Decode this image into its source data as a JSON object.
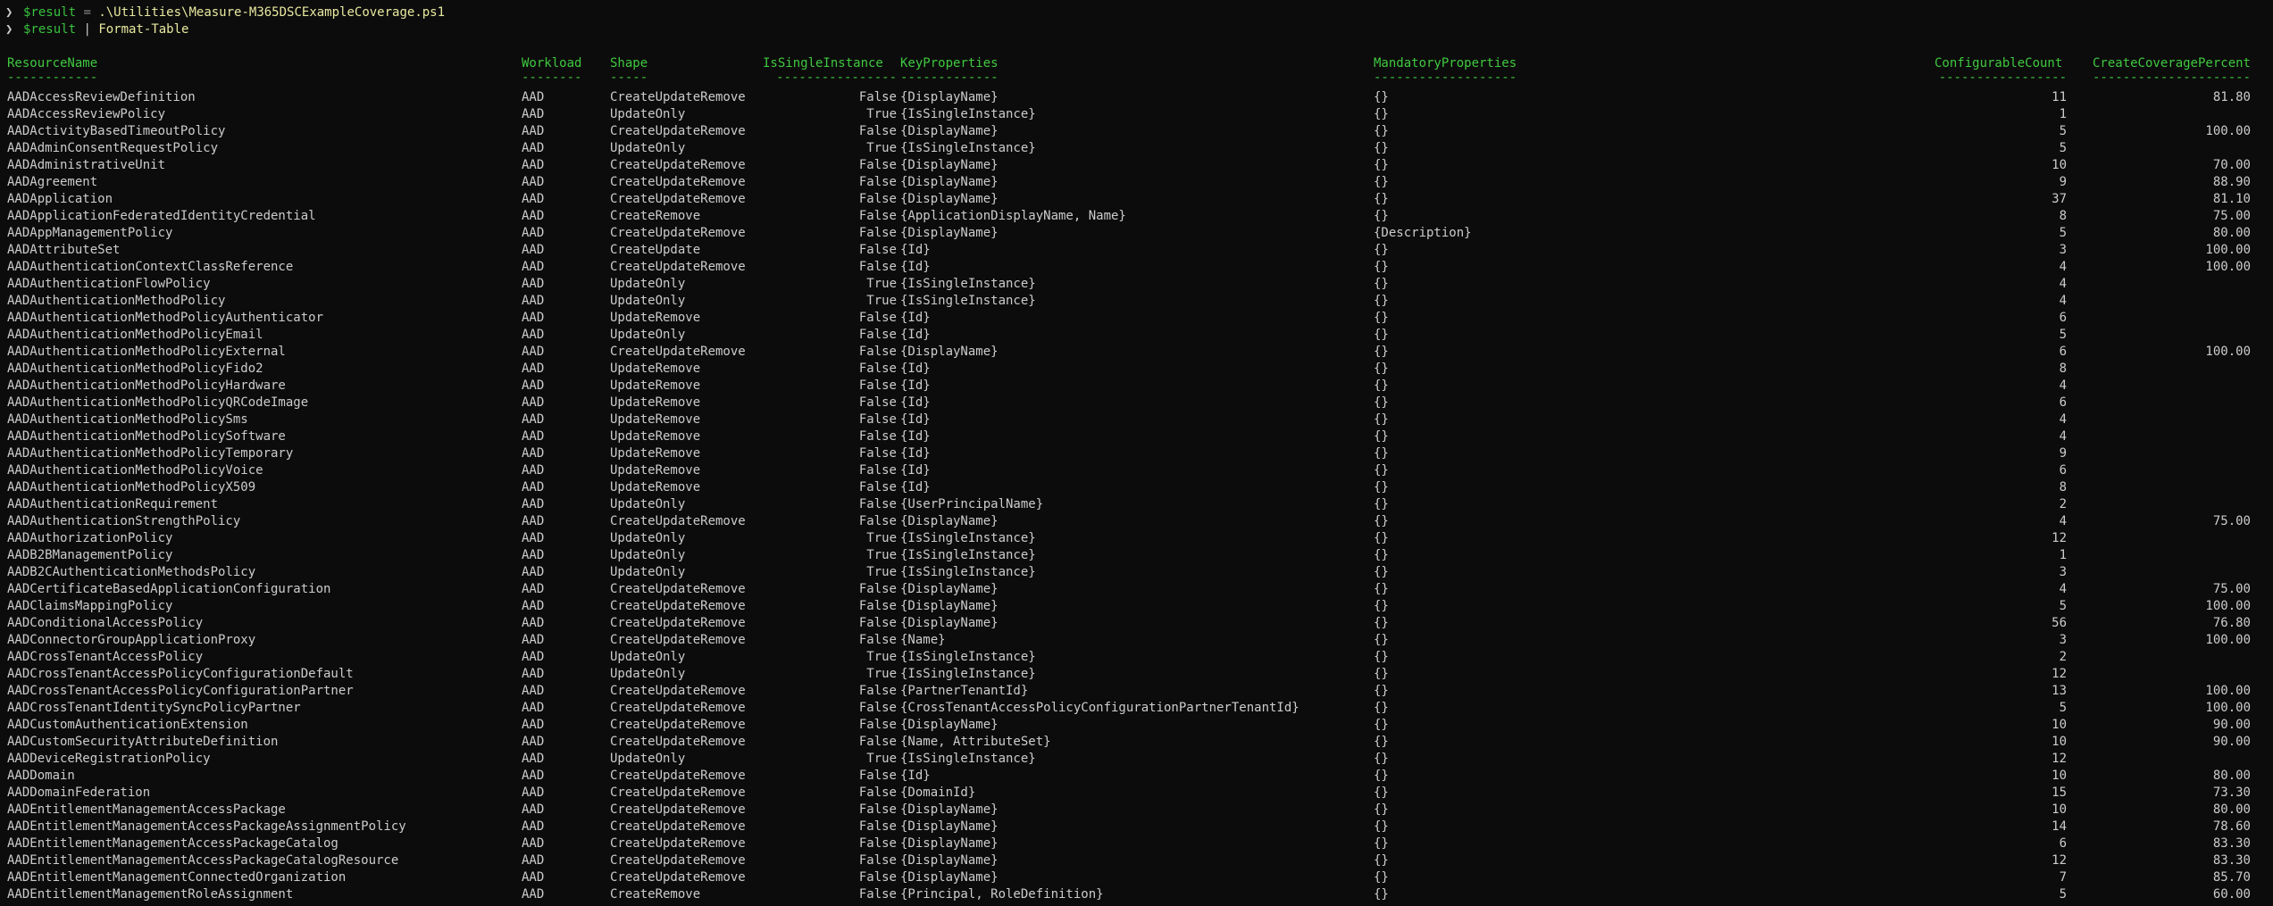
{
  "prompt": {
    "glyph": "❯",
    "line1": {
      "var": "$result",
      "op": " = ",
      "path": ".\\Utilities\\Measure-M365DSCExampleCoverage.ps1"
    },
    "line2": {
      "var": "$result",
      "pipe": " | ",
      "cmd": "Format-Table"
    }
  },
  "table": {
    "columns": [
      "ResourceName",
      "Workload",
      "Shape",
      "IsSingleInstance",
      "KeyProperties",
      "MandatoryProperties",
      "ConfigurableCount",
      "CreateCoveragePercent"
    ],
    "separators": [
      "------------",
      "--------",
      "-----",
      "----------------",
      "-------------",
      "-------------------",
      "-----------------",
      "---------------------"
    ],
    "rows": [
      [
        "AADAccessReviewDefinition",
        "AAD",
        "CreateUpdateRemove",
        "False",
        "{DisplayName}",
        "{}",
        "11",
        "81.80"
      ],
      [
        "AADAccessReviewPolicy",
        "AAD",
        "UpdateOnly",
        "True",
        "{IsSingleInstance}",
        "{}",
        "1",
        ""
      ],
      [
        "AADActivityBasedTimeoutPolicy",
        "AAD",
        "CreateUpdateRemove",
        "False",
        "{DisplayName}",
        "{}",
        "5",
        "100.00"
      ],
      [
        "AADAdminConsentRequestPolicy",
        "AAD",
        "UpdateOnly",
        "True",
        "{IsSingleInstance}",
        "{}",
        "5",
        ""
      ],
      [
        "AADAdministrativeUnit",
        "AAD",
        "CreateUpdateRemove",
        "False",
        "{DisplayName}",
        "{}",
        "10",
        "70.00"
      ],
      [
        "AADAgreement",
        "AAD",
        "CreateUpdateRemove",
        "False",
        "{DisplayName}",
        "{}",
        "9",
        "88.90"
      ],
      [
        "AADApplication",
        "AAD",
        "CreateUpdateRemove",
        "False",
        "{DisplayName}",
        "{}",
        "37",
        "81.10"
      ],
      [
        "AADApplicationFederatedIdentityCredential",
        "AAD",
        "CreateRemove",
        "False",
        "{ApplicationDisplayName, Name}",
        "{}",
        "8",
        "75.00"
      ],
      [
        "AADAppManagementPolicy",
        "AAD",
        "CreateUpdateRemove",
        "False",
        "{DisplayName}",
        "{Description}",
        "5",
        "80.00"
      ],
      [
        "AADAttributeSet",
        "AAD",
        "CreateUpdate",
        "False",
        "{Id}",
        "{}",
        "3",
        "100.00"
      ],
      [
        "AADAuthenticationContextClassReference",
        "AAD",
        "CreateUpdateRemove",
        "False",
        "{Id}",
        "{}",
        "4",
        "100.00"
      ],
      [
        "AADAuthenticationFlowPolicy",
        "AAD",
        "UpdateOnly",
        "True",
        "{IsSingleInstance}",
        "{}",
        "4",
        ""
      ],
      [
        "AADAuthenticationMethodPolicy",
        "AAD",
        "UpdateOnly",
        "True",
        "{IsSingleInstance}",
        "{}",
        "4",
        ""
      ],
      [
        "AADAuthenticationMethodPolicyAuthenticator",
        "AAD",
        "UpdateRemove",
        "False",
        "{Id}",
        "{}",
        "6",
        ""
      ],
      [
        "AADAuthenticationMethodPolicyEmail",
        "AAD",
        "UpdateOnly",
        "False",
        "{Id}",
        "{}",
        "5",
        ""
      ],
      [
        "AADAuthenticationMethodPolicyExternal",
        "AAD",
        "CreateUpdateRemove",
        "False",
        "{DisplayName}",
        "{}",
        "6",
        "100.00"
      ],
      [
        "AADAuthenticationMethodPolicyFido2",
        "AAD",
        "UpdateRemove",
        "False",
        "{Id}",
        "{}",
        "8",
        ""
      ],
      [
        "AADAuthenticationMethodPolicyHardware",
        "AAD",
        "UpdateRemove",
        "False",
        "{Id}",
        "{}",
        "4",
        ""
      ],
      [
        "AADAuthenticationMethodPolicyQRCodeImage",
        "AAD",
        "UpdateRemove",
        "False",
        "{Id}",
        "{}",
        "6",
        ""
      ],
      [
        "AADAuthenticationMethodPolicySms",
        "AAD",
        "UpdateRemove",
        "False",
        "{Id}",
        "{}",
        "4",
        ""
      ],
      [
        "AADAuthenticationMethodPolicySoftware",
        "AAD",
        "UpdateRemove",
        "False",
        "{Id}",
        "{}",
        "4",
        ""
      ],
      [
        "AADAuthenticationMethodPolicyTemporary",
        "AAD",
        "UpdateRemove",
        "False",
        "{Id}",
        "{}",
        "9",
        ""
      ],
      [
        "AADAuthenticationMethodPolicyVoice",
        "AAD",
        "UpdateRemove",
        "False",
        "{Id}",
        "{}",
        "6",
        ""
      ],
      [
        "AADAuthenticationMethodPolicyX509",
        "AAD",
        "UpdateRemove",
        "False",
        "{Id}",
        "{}",
        "8",
        ""
      ],
      [
        "AADAuthenticationRequirement",
        "AAD",
        "UpdateOnly",
        "False",
        "{UserPrincipalName}",
        "{}",
        "2",
        ""
      ],
      [
        "AADAuthenticationStrengthPolicy",
        "AAD",
        "CreateUpdateRemove",
        "False",
        "{DisplayName}",
        "{}",
        "4",
        "75.00"
      ],
      [
        "AADAuthorizationPolicy",
        "AAD",
        "UpdateOnly",
        "True",
        "{IsSingleInstance}",
        "{}",
        "12",
        ""
      ],
      [
        "AADB2BManagementPolicy",
        "AAD",
        "UpdateOnly",
        "True",
        "{IsSingleInstance}",
        "{}",
        "1",
        ""
      ],
      [
        "AADB2CAuthenticationMethodsPolicy",
        "AAD",
        "UpdateOnly",
        "True",
        "{IsSingleInstance}",
        "{}",
        "3",
        ""
      ],
      [
        "AADCertificateBasedApplicationConfiguration",
        "AAD",
        "CreateUpdateRemove",
        "False",
        "{DisplayName}",
        "{}",
        "4",
        "75.00"
      ],
      [
        "AADClaimsMappingPolicy",
        "AAD",
        "CreateUpdateRemove",
        "False",
        "{DisplayName}",
        "{}",
        "5",
        "100.00"
      ],
      [
        "AADConditionalAccessPolicy",
        "AAD",
        "CreateUpdateRemove",
        "False",
        "{DisplayName}",
        "{}",
        "56",
        "76.80"
      ],
      [
        "AADConnectorGroupApplicationProxy",
        "AAD",
        "CreateUpdateRemove",
        "False",
        "{Name}",
        "{}",
        "3",
        "100.00"
      ],
      [
        "AADCrossTenantAccessPolicy",
        "AAD",
        "UpdateOnly",
        "True",
        "{IsSingleInstance}",
        "{}",
        "2",
        ""
      ],
      [
        "AADCrossTenantAccessPolicyConfigurationDefault",
        "AAD",
        "UpdateOnly",
        "True",
        "{IsSingleInstance}",
        "{}",
        "12",
        ""
      ],
      [
        "AADCrossTenantAccessPolicyConfigurationPartner",
        "AAD",
        "CreateUpdateRemove",
        "False",
        "{PartnerTenantId}",
        "{}",
        "13",
        "100.00"
      ],
      [
        "AADCrossTenantIdentitySyncPolicyPartner",
        "AAD",
        "CreateUpdateRemove",
        "False",
        "{CrossTenantAccessPolicyConfigurationPartnerTenantId}",
        "{}",
        "5",
        "100.00"
      ],
      [
        "AADCustomAuthenticationExtension",
        "AAD",
        "CreateUpdateRemove",
        "False",
        "{DisplayName}",
        "{}",
        "10",
        "90.00"
      ],
      [
        "AADCustomSecurityAttributeDefinition",
        "AAD",
        "CreateUpdateRemove",
        "False",
        "{Name, AttributeSet}",
        "{}",
        "10",
        "90.00"
      ],
      [
        "AADDeviceRegistrationPolicy",
        "AAD",
        "UpdateOnly",
        "True",
        "{IsSingleInstance}",
        "{}",
        "12",
        ""
      ],
      [
        "AADDomain",
        "AAD",
        "CreateUpdateRemove",
        "False",
        "{Id}",
        "{}",
        "10",
        "80.00"
      ],
      [
        "AADDomainFederation",
        "AAD",
        "CreateUpdateRemove",
        "False",
        "{DomainId}",
        "{}",
        "15",
        "73.30"
      ],
      [
        "AADEntitlementManagementAccessPackage",
        "AAD",
        "CreateUpdateRemove",
        "False",
        "{DisplayName}",
        "{}",
        "10",
        "80.00"
      ],
      [
        "AADEntitlementManagementAccessPackageAssignmentPolicy",
        "AAD",
        "CreateUpdateRemove",
        "False",
        "{DisplayName}",
        "{}",
        "14",
        "78.60"
      ],
      [
        "AADEntitlementManagementAccessPackageCatalog",
        "AAD",
        "CreateUpdateRemove",
        "False",
        "{DisplayName}",
        "{}",
        "6",
        "83.30"
      ],
      [
        "AADEntitlementManagementAccessPackageCatalogResource",
        "AAD",
        "CreateUpdateRemove",
        "False",
        "{DisplayName}",
        "{}",
        "12",
        "83.30"
      ],
      [
        "AADEntitlementManagementConnectedOrganization",
        "AAD",
        "CreateUpdateRemove",
        "False",
        "{DisplayName}",
        "{}",
        "7",
        "85.70"
      ],
      [
        "AADEntitlementManagementRoleAssignment",
        "AAD",
        "CreateRemove",
        "False",
        "{Principal, RoleDefinition}",
        "{}",
        "5",
        "60.00"
      ]
    ]
  }
}
